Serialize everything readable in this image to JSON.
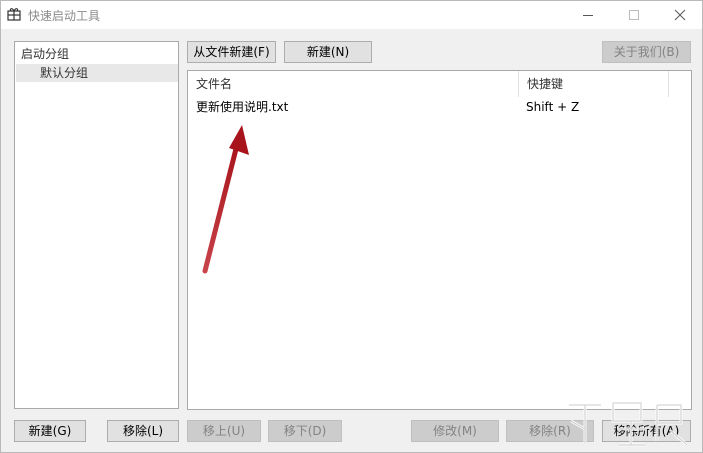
{
  "window": {
    "title": "快速启动工具"
  },
  "groups": {
    "root": "启动分组",
    "selected": "默认分组"
  },
  "toolbar": {
    "new_from_file": "从文件新建(F)",
    "new": "新建(N)",
    "about": "关于我们(B)"
  },
  "file_table": {
    "columns": [
      "文件名",
      "快捷键"
    ],
    "rows": [
      {
        "name": "更新使用说明.txt",
        "hotkey": "Shift + Z"
      }
    ]
  },
  "bottom": {
    "group_new": "新建(G)",
    "group_remove": "移除(L)",
    "move_up": "移上(U)",
    "move_down": "移下(D)",
    "modify": "修改(M)",
    "remove": "移除(R)",
    "remove_all": "移除所有(A)"
  },
  "colors": {
    "annotation_arrow": "#b11f24"
  }
}
